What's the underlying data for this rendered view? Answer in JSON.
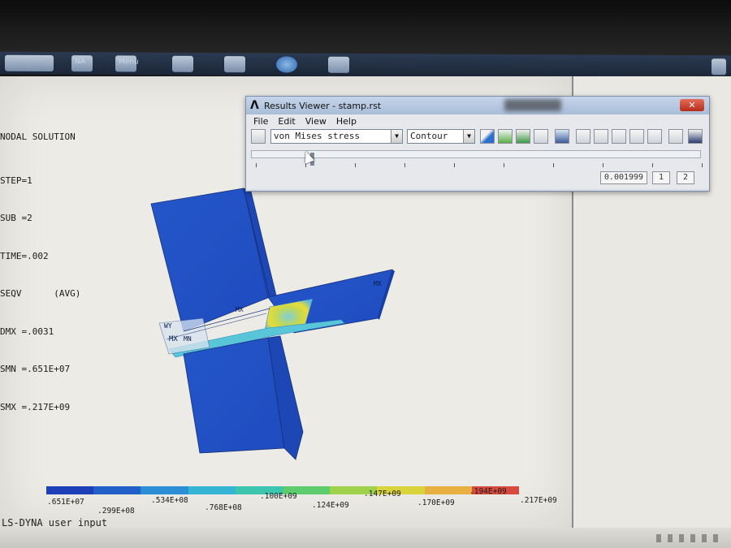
{
  "taskbar": {
    "items": [
      {
        "label": ""
      },
      {
        "label": "NA"
      },
      {
        "label": "Menu"
      },
      {
        "label": ""
      },
      {
        "label": ""
      },
      {
        "label": ""
      },
      {
        "label": ""
      }
    ]
  },
  "legend": {
    "title": "NODAL SOLUTION",
    "lines": [
      "STEP=1",
      "SUB =2",
      "TIME=.002",
      "SEQV      (AVG)",
      "DMX =.0031",
      "SMN =.651E+07",
      "SMX =.217E+09"
    ]
  },
  "model": {
    "labels": {
      "mx_center": "MX",
      "mx_right": "MX",
      "mx_left": "MX",
      "mn_left": "MN",
      "wy": "WY"
    }
  },
  "colorbar": {
    "colors": [
      "#1f3fb8",
      "#2060c8",
      "#2c8ed6",
      "#35b4d6",
      "#3cc6b0",
      "#5ccc6c",
      "#9fd24a",
      "#d8d43a",
      "#e8b040",
      "#d84a3c"
    ],
    "labels_top": [
      ".100E+09",
      ".147E+09",
      ".194E+09"
    ],
    "labels_low_row1": [
      ".651E+07",
      ".534E+08",
      ".124E+09",
      ".170E+09",
      ".217E+09"
    ],
    "labels_low_row2": [
      ".299E+08",
      ".768E+08"
    ]
  },
  "status": {
    "text": "LS-DYNA user input"
  },
  "results_viewer": {
    "logo": "Λ",
    "title": "Results Viewer - stamp.rst",
    "close": "✕",
    "menu": [
      "File",
      "Edit",
      "View",
      "Help"
    ],
    "result_item": "von Mises stress",
    "plot_style": "Contour",
    "time_value": "0.001999",
    "step_current": "1",
    "step_total": "2"
  }
}
